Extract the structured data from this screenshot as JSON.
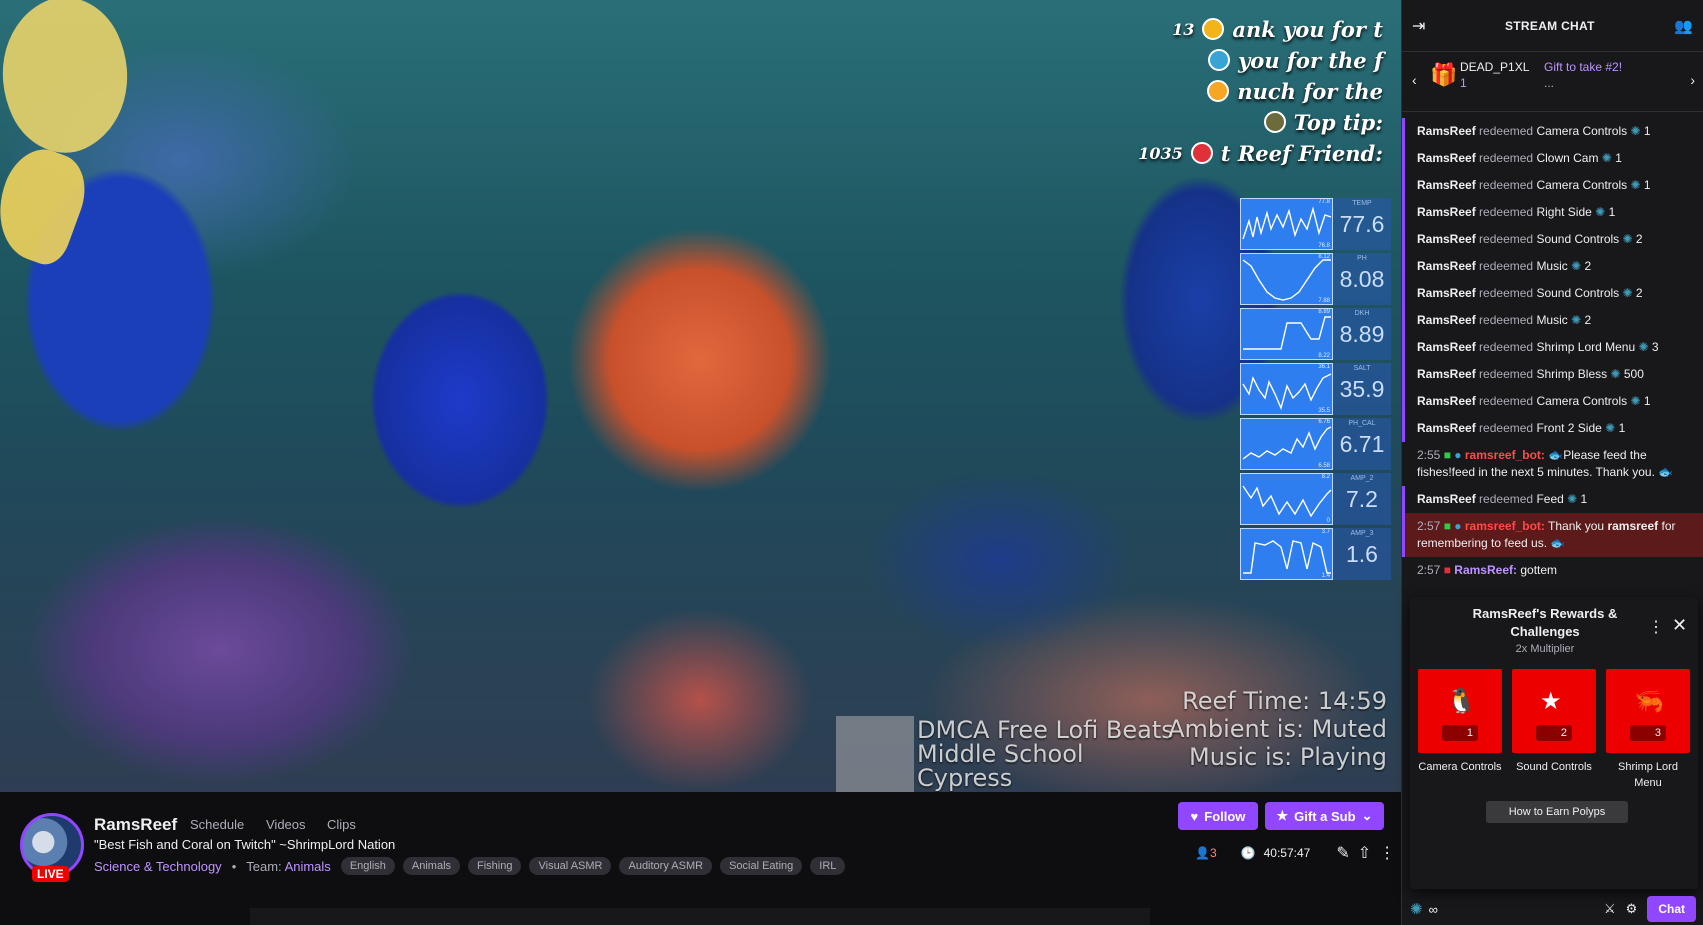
{
  "overlay": {
    "alerts": [
      {
        "count": "13",
        "text": "ank you for t"
      },
      {
        "count": "",
        "text": "you for the f"
      },
      {
        "count": "",
        "text": "nuch for the"
      },
      {
        "count": "",
        "text": "Top tip: "
      },
      {
        "count": "1035",
        "text": "t Reef Friend:"
      }
    ],
    "sensors": [
      {
        "label": "TEMP",
        "value": "77.6",
        "max": "77.8",
        "min": "76.8"
      },
      {
        "label": "PH",
        "value": "8.08",
        "max": "8.12",
        "min": "7.88"
      },
      {
        "label": "DKH",
        "value": "8.89",
        "max": "8.89",
        "min": "8.22"
      },
      {
        "label": "SALT",
        "value": "35.9",
        "max": "36.1",
        "min": "35.5"
      },
      {
        "label": "PH_CAL",
        "value": "6.71",
        "max": "6.76",
        "min": "6.58"
      },
      {
        "label": "AMP_2",
        "value": "7.2",
        "max": "8.2",
        "min": "0"
      },
      {
        "label": "AMP_3",
        "value": "1.6",
        "max": "3.7",
        "min": "1.4"
      }
    ],
    "reef_time": "Reef Time: 14:59",
    "ambient": "Ambient is: Muted",
    "music": "Music is:  Playing",
    "track_line1": "DMCA Free Lofi Beats",
    "track_line2": "Middle School",
    "track_line3": "Cypress"
  },
  "channel": {
    "name": "RamsReef",
    "tabs": [
      "Schedule",
      "Videos",
      "Clips"
    ],
    "live_label": "LIVE",
    "title": "\"Best Fish and Coral on Twitch\" ~ShrimpLord Nation",
    "category": "Science & Technology",
    "team_label": "Team:",
    "team": "Animals",
    "tags": [
      "English",
      "Animals",
      "Fishing",
      "Visual ASMR",
      "Auditory ASMR",
      "Social Eating",
      "IRL"
    ],
    "follow_label": "Follow",
    "gift_label": "Gift a Sub",
    "viewers": "3",
    "uptime": "40:57:47"
  },
  "chat": {
    "title": "STREAM CHAT",
    "gift_user": "DEAD_P1XL",
    "gift_count": "1",
    "gift_text": "Gift to take #2!",
    "gift_more": "...",
    "redemptions": [
      {
        "user": "RamsReef",
        "verb": "redeemed",
        "reward": "Camera Controls",
        "cost": "1"
      },
      {
        "user": "RamsReef",
        "verb": "redeemed",
        "reward": "Clown Cam",
        "cost": "1"
      },
      {
        "user": "RamsReef",
        "verb": "redeemed",
        "reward": "Camera Controls",
        "cost": "1"
      },
      {
        "user": "RamsReef",
        "verb": "redeemed",
        "reward": "Right Side",
        "cost": "1"
      },
      {
        "user": "RamsReef",
        "verb": "redeemed",
        "reward": "Sound Controls",
        "cost": "2"
      },
      {
        "user": "RamsReef",
        "verb": "redeemed",
        "reward": "Music",
        "cost": "2"
      },
      {
        "user": "RamsReef",
        "verb": "redeemed",
        "reward": "Sound Controls",
        "cost": "2"
      },
      {
        "user": "RamsReef",
        "verb": "redeemed",
        "reward": "Music",
        "cost": "2"
      },
      {
        "user": "RamsReef",
        "verb": "redeemed",
        "reward": "Shrimp Lord Menu",
        "cost": "3"
      },
      {
        "user": "RamsReef",
        "verb": "redeemed",
        "reward": "Shrimp Bless",
        "cost": "500"
      },
      {
        "user": "RamsReef",
        "verb": "redeemed",
        "reward": "Camera Controls",
        "cost": "1"
      },
      {
        "user": "RamsReef",
        "verb": "redeemed",
        "reward": "Front 2 Side",
        "cost": "1"
      }
    ],
    "bot1": {
      "time": "2:55",
      "user": "ramsreef_bot:",
      "text": "Please feed the fishes!feed in the next 5 minutes. Thank you."
    },
    "feed": {
      "user": "RamsReef",
      "verb": "redeemed",
      "reward": "Feed",
      "cost": "1"
    },
    "bot2": {
      "time": "2:57",
      "user": "ramsreef_bot:",
      "text_a": "Thank you",
      "mention": "ramsreef",
      "text_b": "for remembering to feed us."
    },
    "last": {
      "time": "2:57",
      "user": "RamsReef:",
      "text": "gottem"
    },
    "input_points": "∞",
    "chat_button": "Chat"
  },
  "rewards": {
    "title": "RamsReef's Rewards & Challenges",
    "multiplier": "2x Multiplier",
    "items": [
      {
        "name": "Camera Controls",
        "cost": "1"
      },
      {
        "name": "Sound Controls",
        "cost": "2"
      },
      {
        "name": "Shrimp Lord Menu",
        "cost": "3"
      }
    ],
    "how_to": "How to Earn Polyps"
  }
}
